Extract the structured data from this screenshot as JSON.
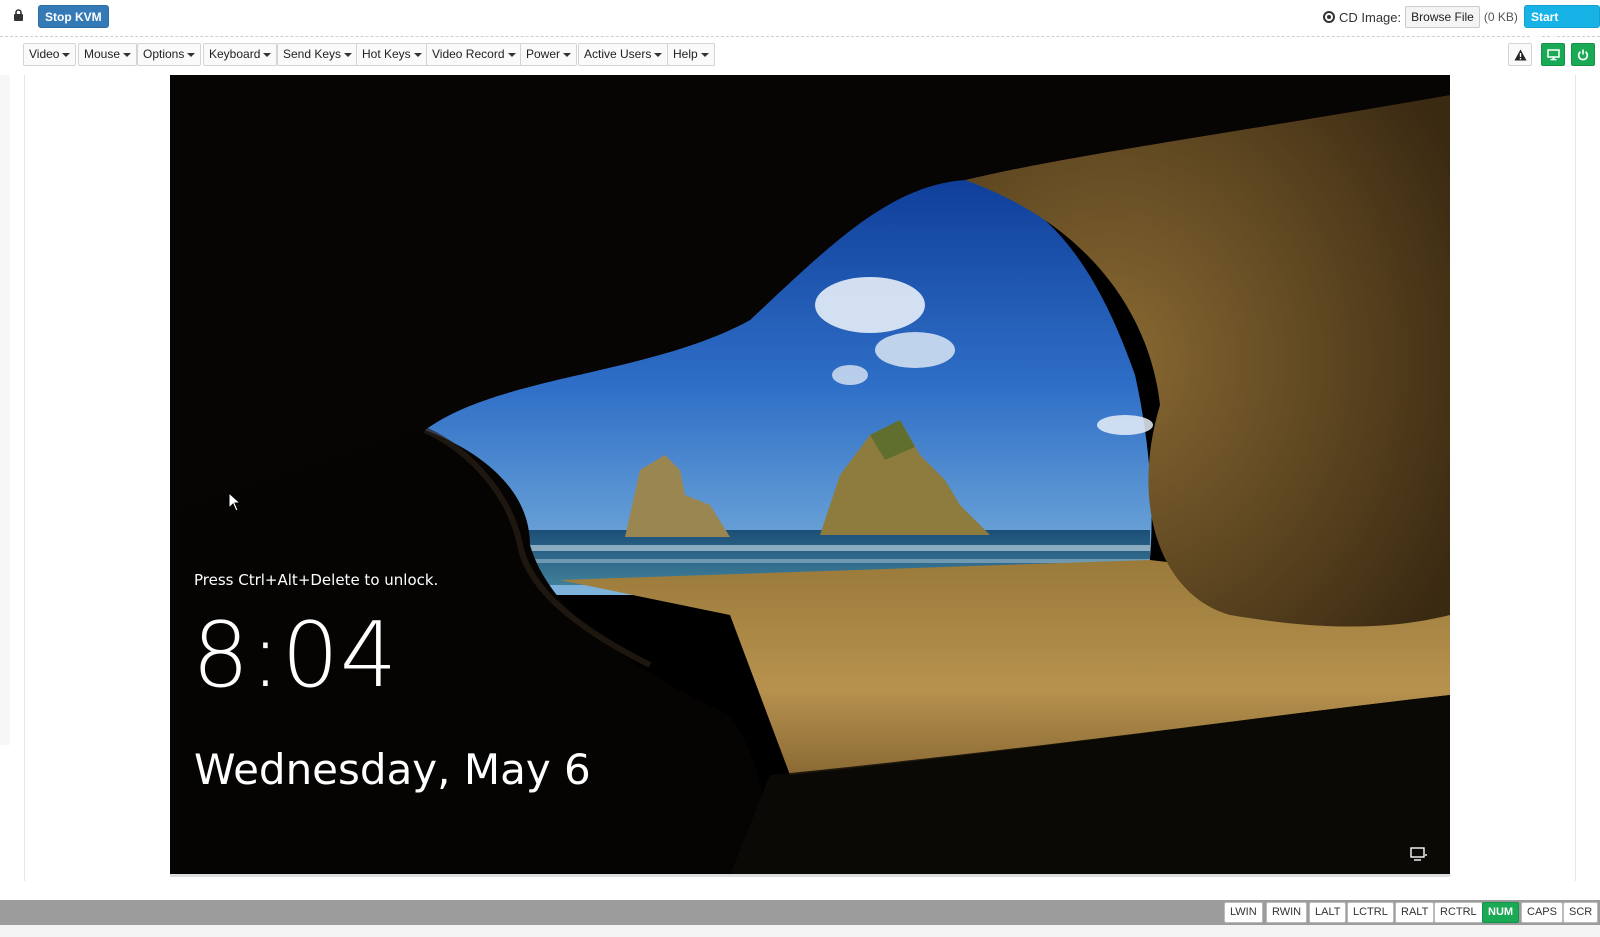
{
  "topbar": {
    "stop_kvm_label": "Stop KVM",
    "cd_image_label": "CD Image:",
    "browse_file_label": "Browse File",
    "cd_size": "(0 KB)",
    "start_media_label": "Start Media"
  },
  "toolbar": {
    "menus": [
      "Video",
      "Mouse",
      "Options",
      "Keyboard",
      "Send Keys",
      "Hot Keys",
      "Video Record",
      "Power",
      "Active Users",
      "Help"
    ]
  },
  "screen": {
    "unlock_hint": "Press Ctrl+Alt+Delete to unlock.",
    "time": "8:04",
    "date": "Wednesday, May 6"
  },
  "statusbar": {
    "keys": [
      {
        "label": "LWIN",
        "active": false
      },
      {
        "label": "RWIN",
        "active": false
      },
      {
        "label": "LALT",
        "active": false
      },
      {
        "label": "LCTRL",
        "active": false
      },
      {
        "label": "RALT",
        "active": false
      },
      {
        "label": "RCTRL",
        "active": false
      },
      {
        "label": "NUM",
        "active": true
      },
      {
        "label": "CAPS",
        "active": false
      },
      {
        "label": "SCR",
        "active": false
      }
    ]
  },
  "colors": {
    "stop_kvm": "#337ab7",
    "start_media": "#17b3e6",
    "status_green": "#1aaa55",
    "statusbar_bg": "#9c9c9c"
  },
  "icons": [
    "lock-icon",
    "cd-icon",
    "warning-icon",
    "monitor-icon",
    "power-icon",
    "cursor-icon",
    "network-icon"
  ]
}
